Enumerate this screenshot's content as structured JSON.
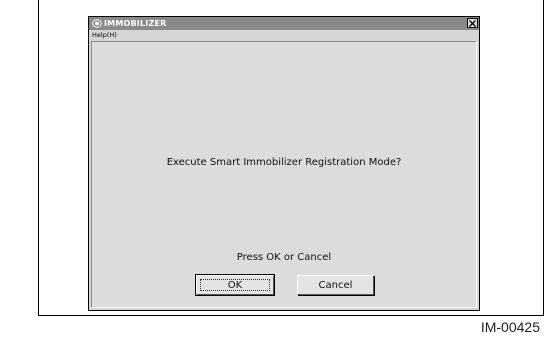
{
  "window": {
    "title": "IMMOBILIZER",
    "app_icon": "immobilizer-app-icon",
    "close_icon": "close-icon"
  },
  "menu": {
    "items": [
      {
        "label": "Help(H)"
      }
    ]
  },
  "dialog": {
    "prompt": "Execute Smart Immobilizer Registration Mode?",
    "instruction": "Press OK or Cancel",
    "ok_label": "OK",
    "cancel_label": "Cancel"
  },
  "figure_id": "IM-00425"
}
